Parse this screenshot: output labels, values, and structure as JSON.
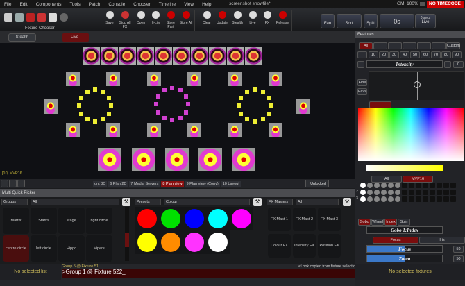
{
  "menu": [
    "File",
    "Edit",
    "Components",
    "Tools",
    "Patch",
    "Console",
    "Chooser",
    "Timeline",
    "View",
    "Help"
  ],
  "title": "screenshot showfile*",
  "gm": "GM: 100%",
  "timecode": "NO TIMECODE",
  "toolbar": {
    "fixture_chooser": "Fixture Chooser",
    "buttons": [
      "Save",
      "Stop All FX",
      "Open",
      "Hi-Lite",
      "Store Part",
      "Store All",
      "Clear",
      "Update",
      "Stealth",
      "Live",
      "FX",
      "Release"
    ],
    "fan": "Fan",
    "sort": "Sort",
    "split": "Split",
    "time": "0s",
    "secs": "0 secs",
    "live": "Live"
  },
  "stealth": "Stealth",
  "live_tab": "Live",
  "plan": {
    "label": "[10] MVP16",
    "tabs": [
      "ont 3D",
      "6 Plan 2D",
      "7 Media Servers",
      "8 Plan view",
      "9 Plan view (Copy)",
      "10 Layout"
    ],
    "active_tab": 3,
    "unlocked": "Unlocked"
  },
  "picker": {
    "title": "Multi Quick Picker",
    "groups_filter": "Groups",
    "groups_value": "All",
    "groups": [
      "Matrix",
      "Starks",
      "stage",
      "right circle",
      "centre circle",
      "left circle",
      "Hippo",
      "Vipers"
    ],
    "selected_group": 4,
    "presets_filter": "Presets",
    "presets_value": "Colour",
    "colours": [
      "#ff0000",
      "#00e000",
      "#0000ff",
      "#00ffff",
      "#ff00ff",
      "#ffff00",
      "#ff8c00",
      "#ff33ff",
      "#ffffff"
    ],
    "fx_filter": "FX Masters",
    "fx_value": "All",
    "fx": [
      "FX Mast 1",
      "FX Mast 2",
      "FX Mast 3",
      "Colour FX",
      "Intensity FX",
      "Position FX"
    ]
  },
  "command": {
    "no_list": "No selected list",
    "history": "Group 5 @ Fixture 51",
    "line": ">Group 1 @ Fixture 522_",
    "look": "<Look copied from fixture selection>"
  },
  "features": {
    "title": "Features",
    "tabs": [
      "All",
      "",
      "",
      "",
      "",
      "",
      "Custom"
    ],
    "levels": [
      "10",
      "20",
      "30",
      "40",
      "50",
      "60",
      "70",
      "80",
      "90"
    ],
    "intensity": "Intensity",
    "intensity_value": "0",
    "fine": "Fine",
    "favs": "Favs",
    "gobo_tabs": [
      "All",
      "MVP16"
    ],
    "gobo_rows": [
      "1",
      "2",
      "3"
    ],
    "gobo_buttons": [
      "Gobo",
      "Wheel",
      "Index",
      "Spin"
    ],
    "gobo_index": "Gobo 1:Index",
    "focus_tabs": [
      "Focus",
      "Iris"
    ],
    "focus": "Focus",
    "focus_value": "50",
    "zoom": "Zoom",
    "zoom_value": "50",
    "no_fixtures": "No selected fixtures"
  }
}
